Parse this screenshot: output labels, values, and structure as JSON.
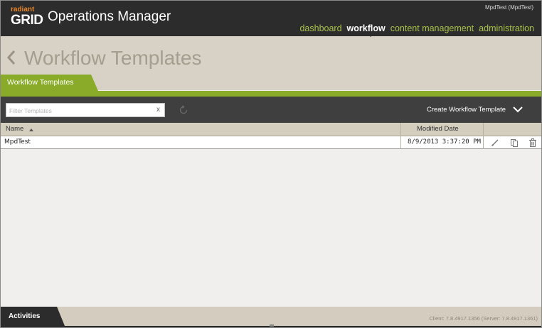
{
  "header": {
    "logo_top": "radiant",
    "logo_bottom": "GRID",
    "app_title": "Operations Manager",
    "user": "MpdTest (MpdTest)",
    "nav": [
      "dashboard",
      "workflow",
      "content management",
      "administration"
    ],
    "active_nav": "workflow"
  },
  "page": {
    "title": "Workflow Templates",
    "tab_label": "Workflow Templates"
  },
  "toolbar": {
    "filter_placeholder": "Filter Templates",
    "filter_clear": "x",
    "create_label": "Create Workflow Template"
  },
  "table": {
    "columns": [
      "Name",
      "Modified Date"
    ],
    "sort_column": "Name",
    "rows": [
      {
        "name": "MpdTest",
        "modified": "8/9/2013 3:37:20 PM"
      }
    ]
  },
  "footer": {
    "activities_label": "Activities",
    "version": "Client: 7.8.4917.1356 (Server: 7.8.4917.1361)"
  },
  "colors": {
    "header_bg": "#2c2c2c",
    "accent_green": "#8aab2a",
    "nav_green": "#a9c24b",
    "logo_orange": "#e8862a",
    "title_area_bg": "#d8d2c6",
    "toolbar_bg": "#3f3f3f"
  },
  "icons": [
    "back-chevron-icon",
    "refresh-icon",
    "chevron-down-icon",
    "edit-pencil-icon",
    "copy-icon",
    "trash-icon"
  ]
}
